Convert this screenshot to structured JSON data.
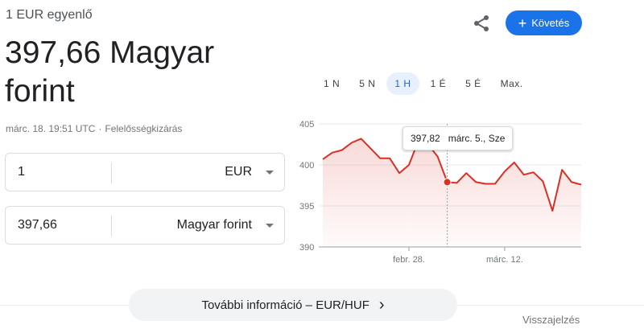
{
  "header": {
    "subtitle": "1 EUR egyenlő",
    "value_line1": "397,66 Magyar",
    "value_line2": "forint",
    "timestamp": "márc. 18. 19:51 UTC",
    "separator": "·",
    "disclaimer": "Felelősségkizárás"
  },
  "actions": {
    "share_icon": "share-icon",
    "follow_icon": "+",
    "follow_label": "Követés",
    "accent_color": "#1a73e8"
  },
  "converter": {
    "from_amount": "1",
    "from_currency": "EUR",
    "to_amount": "397,66",
    "to_currency": "Magyar forint"
  },
  "ranges": [
    {
      "label": "1 N",
      "active": false
    },
    {
      "label": "5 N",
      "active": false
    },
    {
      "label": "1 H",
      "active": true
    },
    {
      "label": "1 É",
      "active": false
    },
    {
      "label": "5 É",
      "active": false
    },
    {
      "label": "Max.",
      "active": false
    }
  ],
  "tooltip": {
    "value": "397,82",
    "date": "márc. 5., Sze"
  },
  "chart_data": {
    "type": "area",
    "ylim": [
      390,
      405
    ],
    "yticks": [
      405,
      400,
      395,
      390
    ],
    "xtick_labels": [
      {
        "label": "febr. 28.",
        "index": 9
      },
      {
        "label": "márc. 12.",
        "index": 19
      }
    ],
    "line_color": "#d93025",
    "series": [
      {
        "values": [
          400.7,
          401.5,
          401.8,
          402.7,
          403.2,
          402.0,
          400.8,
          400.8,
          399.0,
          400.0,
          403.0,
          402.5,
          401.0,
          397.9,
          397.8,
          399.0,
          397.9,
          397.7,
          397.7,
          399.2,
          400.3,
          398.8,
          399.1,
          398.0,
          394.4,
          399.4,
          397.9,
          397.6
        ]
      }
    ],
    "highlight_index": 13
  },
  "footer": {
    "more_label": "További információ – EUR/HUF",
    "more_chevron": "›",
    "feedback": "Visszajelzés"
  }
}
